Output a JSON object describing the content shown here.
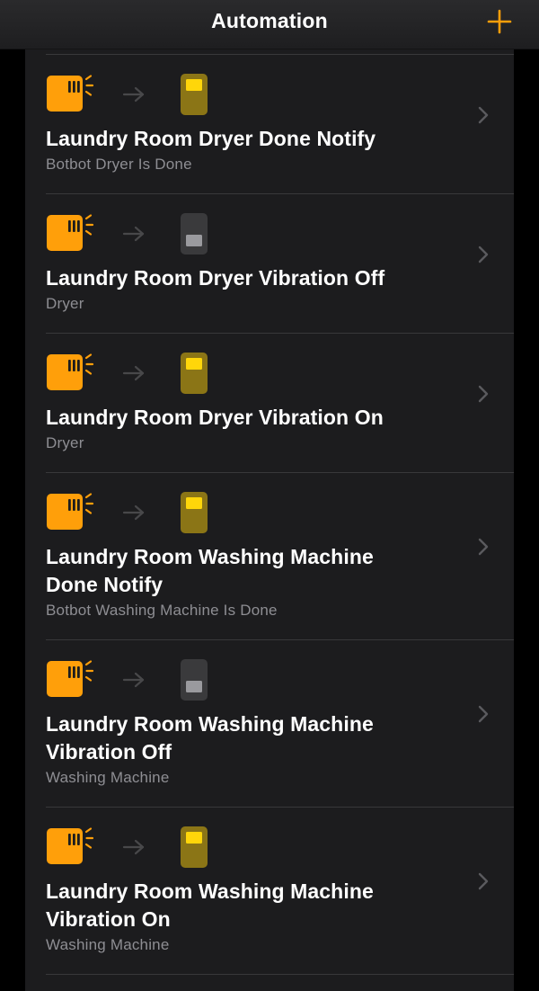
{
  "header": {
    "title": "Automation",
    "add_icon": "plus-icon"
  },
  "colors": {
    "accent": "#ff9f0a",
    "sensor": "#ff9f0a",
    "switch_on_body": "#8b7516",
    "switch_on_paddle": "#ffd60a",
    "switch_off_body": "#3a3a3c",
    "switch_off_paddle": "#9a9a9e",
    "list_background": "#1c1c1e",
    "secondary_text": "#8e8e93"
  },
  "automations": [
    {
      "title_lines": [
        "Laundry Room Dryer Done Notify"
      ],
      "subtitle": "Botbot Dryer Is Done",
      "trigger_icon": "vibration-sensor-icon",
      "action_icon": "switch-on-icon",
      "switch_state": "on"
    },
    {
      "title_lines": [
        "Laundry Room Dryer Vibration Off"
      ],
      "subtitle": "Dryer",
      "trigger_icon": "vibration-sensor-icon",
      "action_icon": "switch-off-icon",
      "switch_state": "off"
    },
    {
      "title_lines": [
        "Laundry Room Dryer Vibration On"
      ],
      "subtitle": "Dryer",
      "trigger_icon": "vibration-sensor-icon",
      "action_icon": "switch-on-icon",
      "switch_state": "on"
    },
    {
      "title_lines": [
        "Laundry Room Washing Machine",
        "Done Notify"
      ],
      "subtitle": "Botbot Washing Machine Is Done",
      "trigger_icon": "vibration-sensor-icon",
      "action_icon": "switch-on-icon",
      "switch_state": "on"
    },
    {
      "title_lines": [
        "Laundry Room Washing Machine",
        "Vibration Off"
      ],
      "subtitle": "Washing Machine",
      "trigger_icon": "vibration-sensor-icon",
      "action_icon": "switch-off-icon",
      "switch_state": "off"
    },
    {
      "title_lines": [
        "Laundry Room Washing Machine",
        "Vibration On"
      ],
      "subtitle": "Washing Machine",
      "trigger_icon": "vibration-sensor-icon",
      "action_icon": "switch-on-icon",
      "switch_state": "on"
    }
  ]
}
